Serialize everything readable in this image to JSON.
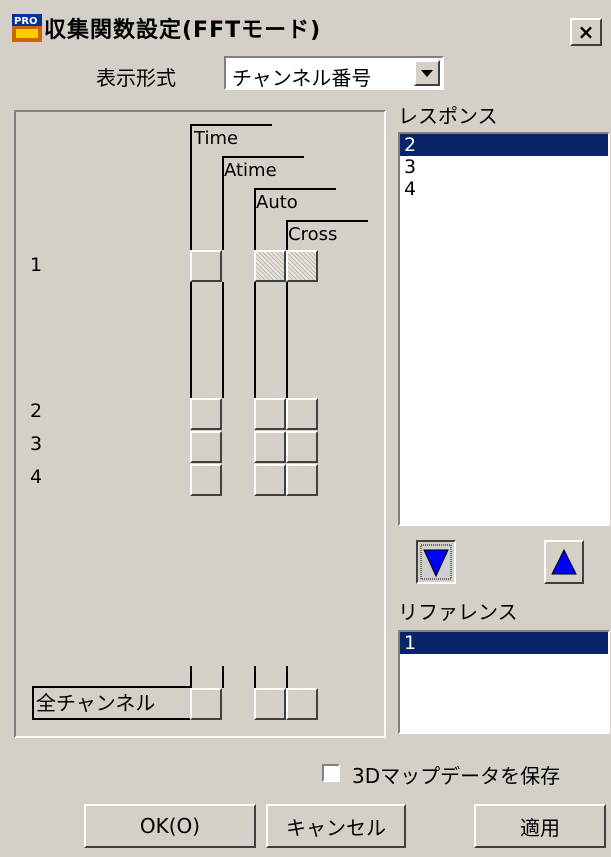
{
  "window": {
    "title": "収集関数設定(FFTモード)",
    "close_label": "×",
    "icon_badge": "PRO"
  },
  "display_format": {
    "label": "表示形式",
    "value": "チャンネル番号"
  },
  "matrix": {
    "columns": [
      "Time",
      "Atime",
      "Auto",
      "Cross"
    ],
    "rows": [
      "1",
      "2",
      "3",
      "4"
    ],
    "all_channels_label": "全チャンネル"
  },
  "response": {
    "label": "レスポンス",
    "items": [
      "2",
      "3",
      "4"
    ],
    "selected": "2"
  },
  "reference": {
    "label": "リファレンス",
    "items": [
      "1"
    ],
    "selected": "1"
  },
  "save_3d": {
    "label": "3Dマップデータを保存",
    "checked": false
  },
  "buttons": {
    "ok": "OK(O)",
    "cancel": "キャンセル",
    "apply": "適用"
  },
  "colors": {
    "selection": "#0a246a",
    "arrow_blue": "#0000ff",
    "face": "#d4d0c8"
  }
}
